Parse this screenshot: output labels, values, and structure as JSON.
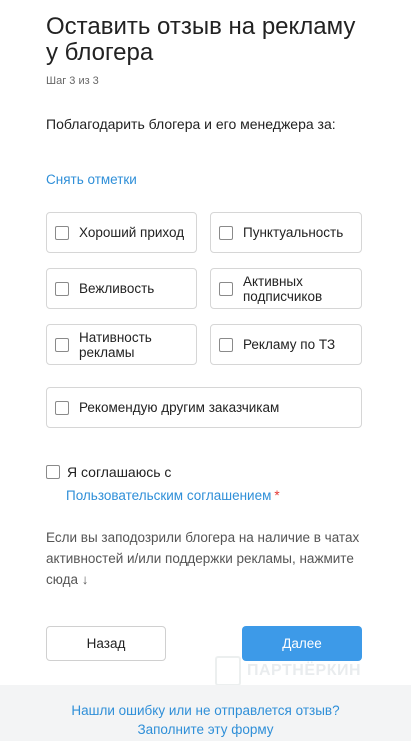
{
  "header": {
    "title": "Оставить отзыв на рекламу у блогера",
    "step": "Шаг 3 из 3"
  },
  "question": "Поблагодарить блогера и его менеджера за:",
  "clear_link": "Снять отметки",
  "options": [
    {
      "label": "Хороший приход",
      "checked": false
    },
    {
      "label": "Пунктуальность",
      "checked": false
    },
    {
      "label": "Вежливость",
      "checked": false
    },
    {
      "label": "Активных подписчиков",
      "checked": false
    },
    {
      "label": "Нативность рекламы",
      "checked": false
    },
    {
      "label": "Рекламу по ТЗ",
      "checked": false
    },
    {
      "label": "Рекомендую другим заказчикам",
      "checked": false
    }
  ],
  "agreement": {
    "label": "Я соглашаюсь с",
    "link": "Пользовательским соглашением",
    "required_mark": "*",
    "checked": false
  },
  "suspect_text": "Если вы заподозрили блогера на наличие в чатах активностей и/или поддержки рекламы, нажмите сюда",
  "suspect_arrow": "↓",
  "buttons": {
    "back": "Назад",
    "next": "Далее"
  },
  "watermark": "ПАРТНЁРКИН",
  "footer": {
    "line1": "Нашли ошибку или не отправлется отзыв?",
    "line2": "Заполните эту форму"
  },
  "colors": {
    "accent": "#3d9ae8",
    "link": "#2f8fd8",
    "required": "#e53935",
    "footer_bg": "#f3f4f5"
  }
}
